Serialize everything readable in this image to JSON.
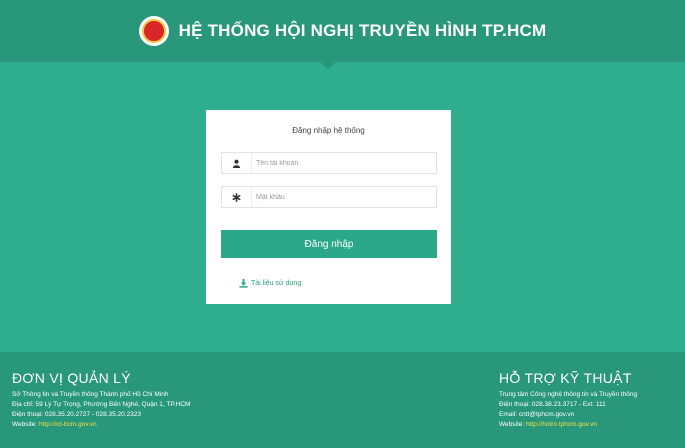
{
  "header": {
    "title": "HỆ THỐNG HỘI NGHỊ TRUYỀN HÌNH TP.HCM"
  },
  "login": {
    "title": "Đăng nhập hệ thống",
    "username_placeholder": "Tên tài khoản",
    "password_placeholder": "Mật khẩu",
    "submit_label": "Đăng nhập",
    "docs_link": "Tài liệu sử dụng"
  },
  "footer": {
    "left": {
      "heading": "ĐƠN VỊ QUẢN LÝ",
      "org": "Sở Thông tin và Truyền thông Thành phố Hồ Chí Minh",
      "address": "Địa chỉ: 59 Lý Tự Trọng, Phường Bến Nghé, Quận 1, TP.HCM",
      "phone": "Điện thoại: 028.35.20.2727 - 028.35.20.2323",
      "website_label": "Website:",
      "website": "http://ict-hcm.gov.vn"
    },
    "right": {
      "heading": "HỖ TRỢ KỸ THUẬT",
      "org": "Trung tâm Công nghệ thông tin và Truyền thông",
      "phone": "Điện thoại: 028.38.23.3717 - Ext: 111",
      "email": "Email: cntt@tphcm.gov.vn",
      "website_label": "Website:",
      "website": "http://hotro.tphcm.gov.vn"
    }
  },
  "colors": {
    "background": "#2eae8c",
    "header": "#28977a",
    "button": "#2aa888",
    "link_yellow": "#f3e04a"
  },
  "icons": {
    "logo": "city-emblem-icon",
    "username": "user-icon",
    "password": "asterisk-icon",
    "docs": "download-icon"
  }
}
